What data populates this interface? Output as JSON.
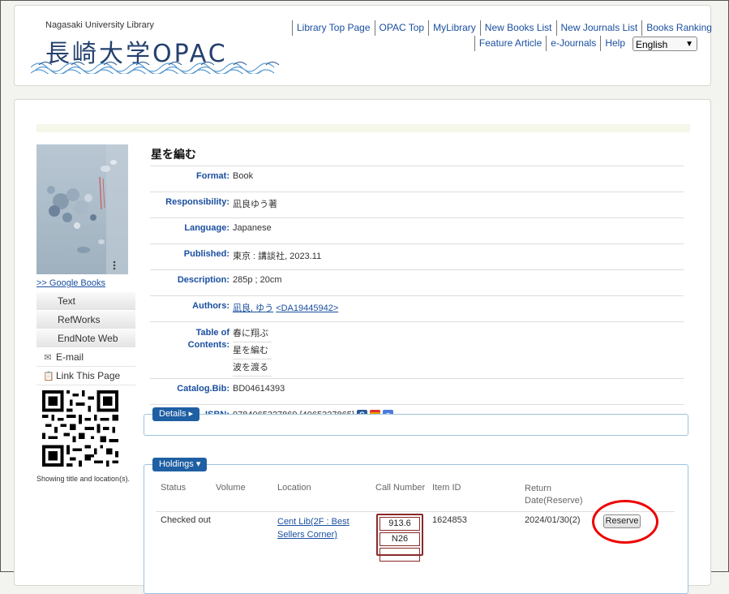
{
  "header": {
    "logo_small": "Nagasaki University Library",
    "logo_big": "長崎大学OPAC",
    "nav_row1": [
      "Library Top Page",
      "OPAC Top",
      "MyLibrary",
      "New Books List",
      "New Journals List",
      "Books Ranking"
    ],
    "nav_row2": [
      "Feature Article",
      "e-Journals",
      "Help"
    ],
    "language": "English"
  },
  "sidebar": {
    "google_books": ">> Google Books",
    "export_text": "Text",
    "export_refworks": "RefWorks",
    "export_endnote": "EndNote Web",
    "email": "E-mail",
    "link_page": "Link This Page",
    "qr_caption": "Showing title and location(s)."
  },
  "record": {
    "title": "星を編む",
    "format_label": "Format:",
    "format": "Book",
    "responsibility_label": "Responsibility:",
    "responsibility": "凪良ゆう著",
    "language_label": "Language:",
    "language": "Japanese",
    "published_label": "Published:",
    "published": "東京 : 講談社, 2023.11",
    "description_label": "Description:",
    "description": "285p ; 20cm",
    "authors_label": "Authors:",
    "author_name": "凪良, ゆう",
    "author_id": "<DA19445942>",
    "toc_label_1": "Table of",
    "toc_label_2": "Contents:",
    "toc": [
      "春に翔ぶ",
      "星を編む",
      "波を渡る"
    ],
    "catalog_label": "Catalog.Bib:",
    "catalog": "BD04614393",
    "isbn_label": "ISBN:",
    "isbn": "9784065327869 [4065327865]"
  },
  "details": {
    "tab": "Details ▸"
  },
  "holdings": {
    "tab": "Holdings ▾",
    "headers": {
      "status": "Status",
      "volume": "Volume",
      "location": "Location",
      "call_number": "Call Number",
      "item_id": "Item ID",
      "return_1": "Return",
      "return_2": "Date(Reserve)"
    },
    "row": {
      "status": "Checked out",
      "location_1": "Cent Lib(2F : Best",
      "location_2": "Sellers Corner)",
      "call_1": "913.6",
      "call_2": "N26",
      "item_id": "1624853",
      "return_date": "2024/01/30(2)",
      "reserve": "Reserve"
    }
  },
  "colors": {
    "link": "#1a4fa0",
    "tab": "#1f5fa3",
    "highlight_circle": "#e00000"
  }
}
